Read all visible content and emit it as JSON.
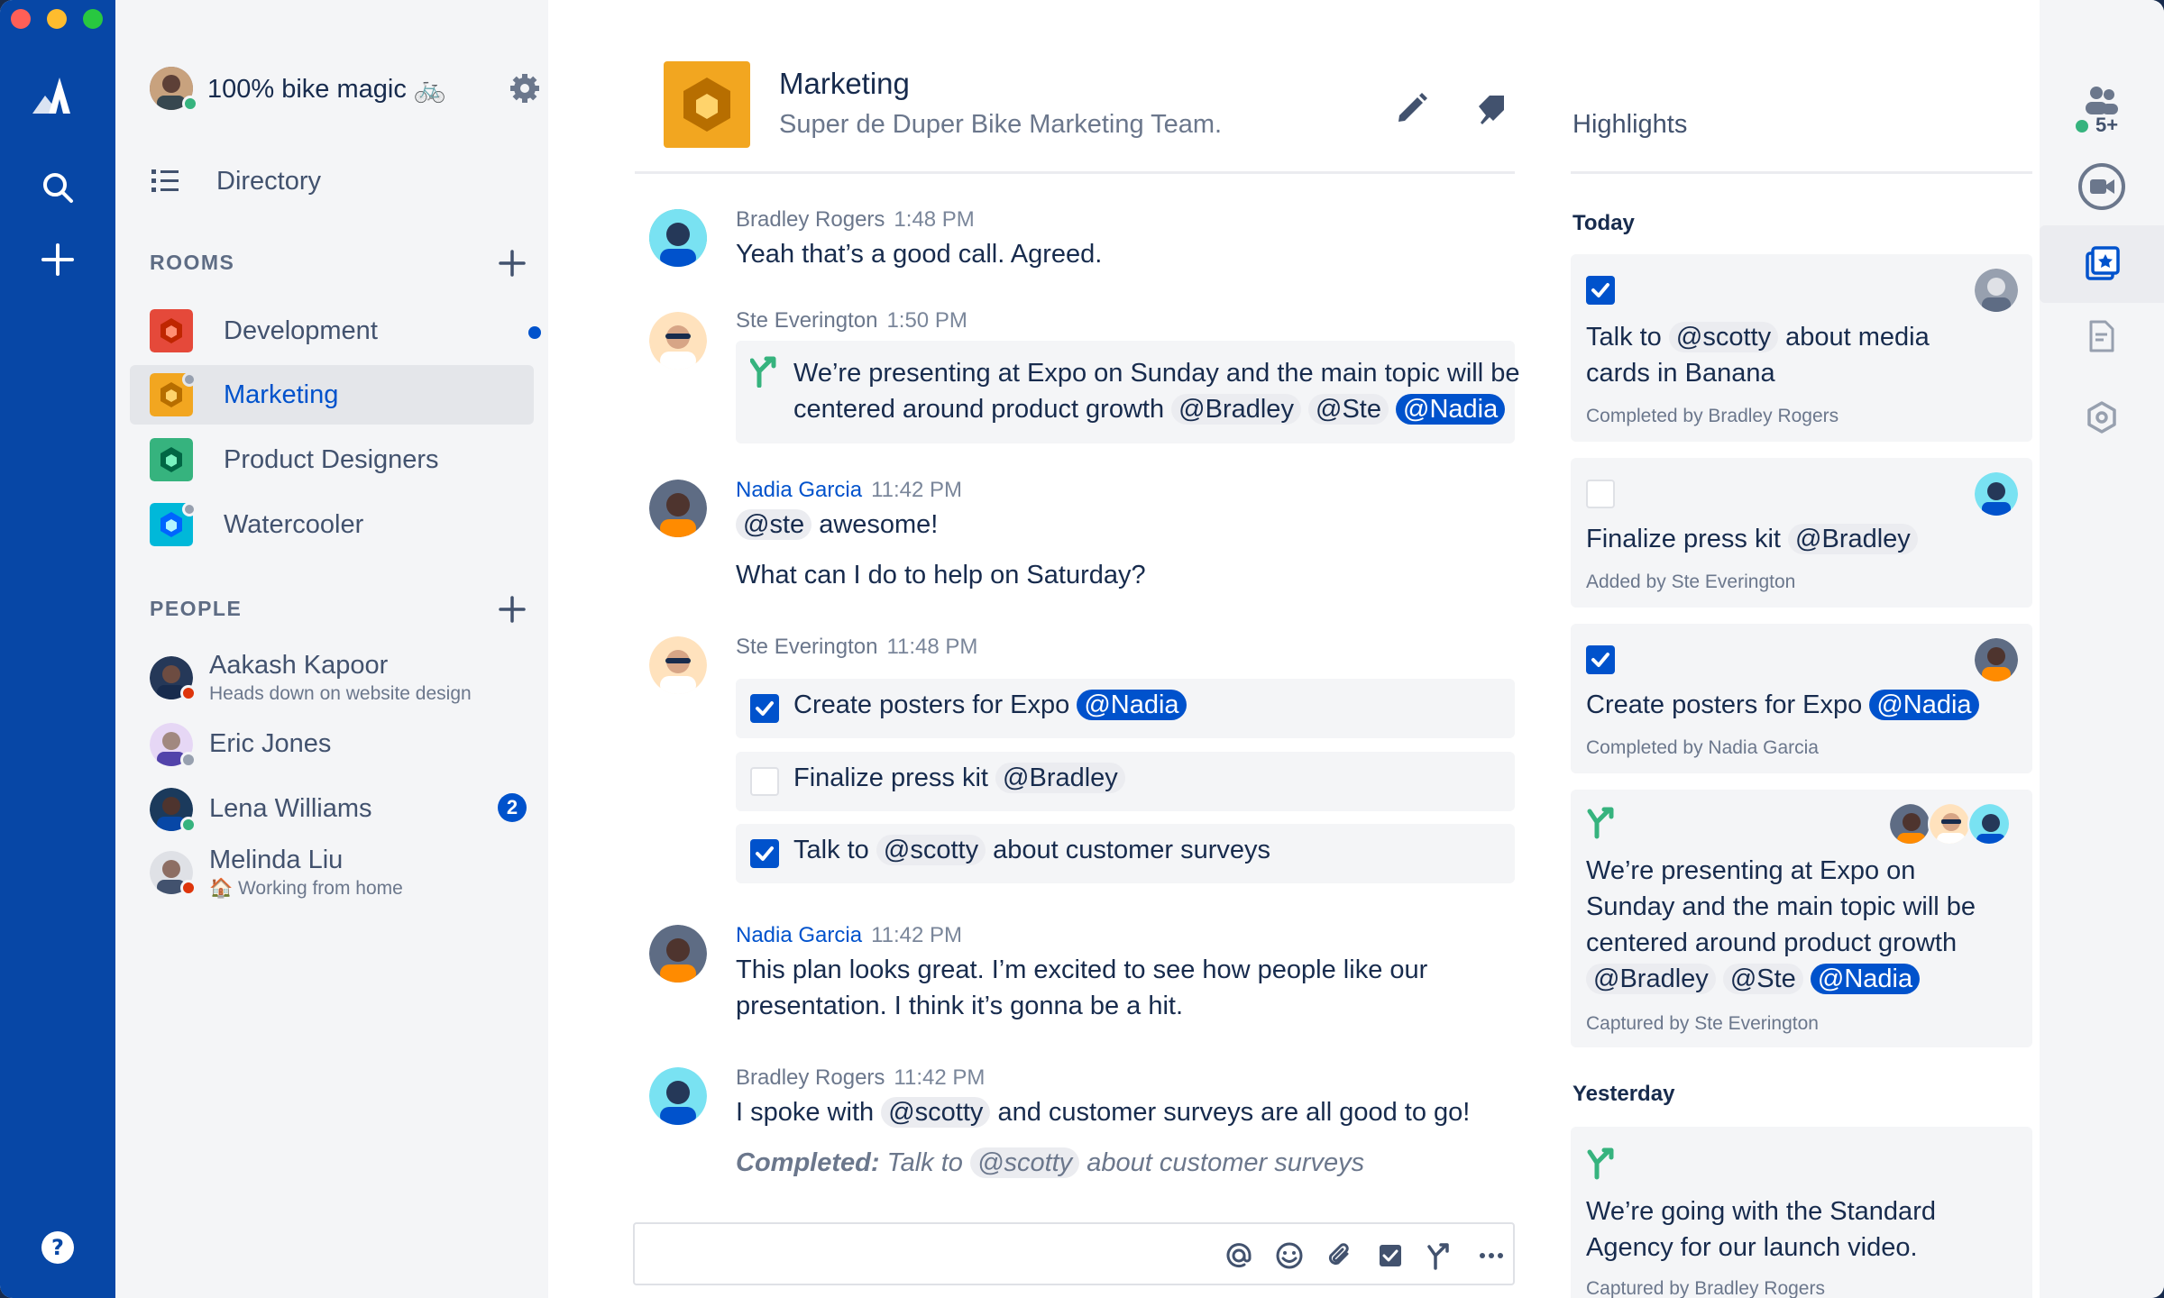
{
  "workspace": {
    "name": "100% bike magic",
    "emoji": "🚲"
  },
  "nav": {
    "directory_label": "Directory"
  },
  "rooms": {
    "section_title": "ROOMS",
    "items": [
      {
        "label": "Development",
        "color": "#E5493A",
        "unread": true
      },
      {
        "label": "Marketing",
        "color": "#F2A620",
        "selected": true
      },
      {
        "label": "Product Designers",
        "color": "#36B37E"
      },
      {
        "label": "Watercooler",
        "color": "#00B8D9"
      }
    ]
  },
  "people": {
    "section_title": "PEOPLE",
    "items": [
      {
        "name": "Aakash Kapoor",
        "status": "Heads down on website design",
        "presence": "busy"
      },
      {
        "name": "Eric Jones",
        "status": "",
        "presence": "away"
      },
      {
        "name": "Lena Williams",
        "status": "",
        "presence": "online",
        "badge": "2"
      },
      {
        "name": "Melinda Liu",
        "status": "🏠 Working from home",
        "presence": "busy"
      }
    ]
  },
  "room_header": {
    "title": "Marketing",
    "description": "Super de Duper Bike Marketing Team."
  },
  "messages": [
    {
      "author": "Bradley Rogers",
      "time": "1:48 PM",
      "text": "Yeah that’s a good call. Agreed."
    },
    {
      "author": "Ste Everington",
      "time": "1:50 PM",
      "decision_line1": "We’re presenting at Expo on Sunday and the main topic will be",
      "decision_line2": "centered around product growth",
      "mentions": [
        "@Bradley",
        "@Ste",
        "@Nadia"
      ]
    },
    {
      "author": "Nadia Garcia",
      "time": "11:42 PM",
      "mention": "@ste",
      "text_after_mention": "awesome!",
      "text2": "What can I do to help on Saturday?"
    },
    {
      "author": "Ste Everington",
      "time": "11:48 PM",
      "tasks": [
        {
          "label": "Create posters for Expo",
          "mention": "@Nadia",
          "done": true
        },
        {
          "label": "Finalize press kit",
          "mention": "@Bradley",
          "done": false
        },
        {
          "label": "Talk to",
          "mention": "@scotty",
          "label_after": "about customer surveys",
          "done": true
        }
      ]
    },
    {
      "author": "Nadia Garcia",
      "time": "11:42 PM",
      "line1": "This plan looks great. I’m excited to see how people like our",
      "line2": "presentation. I think it’s gonna be a hit."
    },
    {
      "author": "Bradley Rogers",
      "time": "11:42 PM",
      "text_before": "I spoke with",
      "mention": "@scotty",
      "text_after": "and customer surveys are all good to go!",
      "completed_label": "Completed:",
      "completed_text": "Talk to",
      "completed_mention": "@scotty",
      "completed_after": "about customer surveys"
    }
  ],
  "highlights": {
    "title": "Highlights",
    "today_label": "Today",
    "yesterday_label": "Yesterday",
    "cards": [
      {
        "line1_before": "Talk to",
        "line1_mention": "@scotty",
        "line1_after": "about media",
        "line2": "cards in Banana",
        "footer": "Completed by Bradley Rogers",
        "done": true
      },
      {
        "line1_before": "Finalize press kit",
        "line1_mention": "@Bradley",
        "footer": "Added by Ste Everington",
        "done": false
      },
      {
        "line1_before": "Create posters for Expo",
        "line1_mention": "@Nadia",
        "footer": "Completed by Nadia Garcia",
        "done": true
      },
      {
        "line1": "We’re presenting at Expo on",
        "line2": "Sunday and the main topic will be",
        "line3": "centered around product growth",
        "mentions": [
          "@Bradley",
          "@Ste",
          "@Nadia"
        ],
        "footer": "Captured by Ste Everington"
      },
      {
        "line1": "We’re going with the Standard",
        "line2": "Agency for our launch video.",
        "footer": "Captured by Bradley Rogers"
      }
    ]
  },
  "right_rail": {
    "participants_count": "5+"
  },
  "colors": {
    "nav": "#0747A6",
    "accent": "#0052CC",
    "decision": "#36B37E",
    "online": "#36B37E",
    "busy": "#DE350B"
  }
}
